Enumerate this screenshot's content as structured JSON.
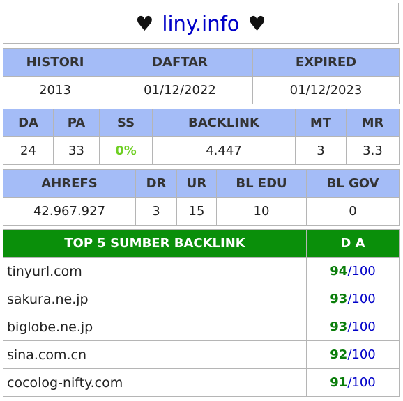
{
  "title": {
    "heart_left": "♥",
    "domain": "liny.info",
    "heart_right": "♥"
  },
  "registration": {
    "headers": [
      "HISTORI",
      "DAFTAR",
      "EXPIRED"
    ],
    "values": [
      "2013",
      "01/12/2022",
      "01/12/2023"
    ]
  },
  "metrics": {
    "headers": [
      "DA",
      "PA",
      "SS",
      "BACKLINK",
      "MT",
      "MR"
    ],
    "values": [
      "24",
      "33",
      "0%",
      "4.447",
      "3",
      "3.3"
    ]
  },
  "ahrefs": {
    "headers": [
      "AHREFS",
      "DR",
      "UR",
      "BL EDU",
      "BL GOV"
    ],
    "values": [
      "42.967.927",
      "3",
      "15",
      "10",
      "0"
    ]
  },
  "top_backlinks": {
    "header_source": "TOP 5 SUMBER BACKLINK",
    "header_da": "D A",
    "rows": [
      {
        "site": "tinyurl.com",
        "da": "94",
        "slash": "/",
        "max": "100"
      },
      {
        "site": "sakura.ne.jp",
        "da": "93",
        "slash": "/",
        "max": "100"
      },
      {
        "site": "biglobe.ne.jp",
        "da": "93",
        "slash": "/",
        "max": "100"
      },
      {
        "site": "sina.com.cn",
        "da": "92",
        "slash": "/",
        "max": "100"
      },
      {
        "site": "cocolog-nifty.com",
        "da": "91",
        "slash": "/",
        "max": "100"
      }
    ]
  },
  "colors": {
    "header_blue": "#a4bcf7",
    "header_green": "#0a8f0a",
    "domain_blue": "#0000c8",
    "ss_green": "#6fcf24",
    "da_green": "#0a7d0a"
  }
}
